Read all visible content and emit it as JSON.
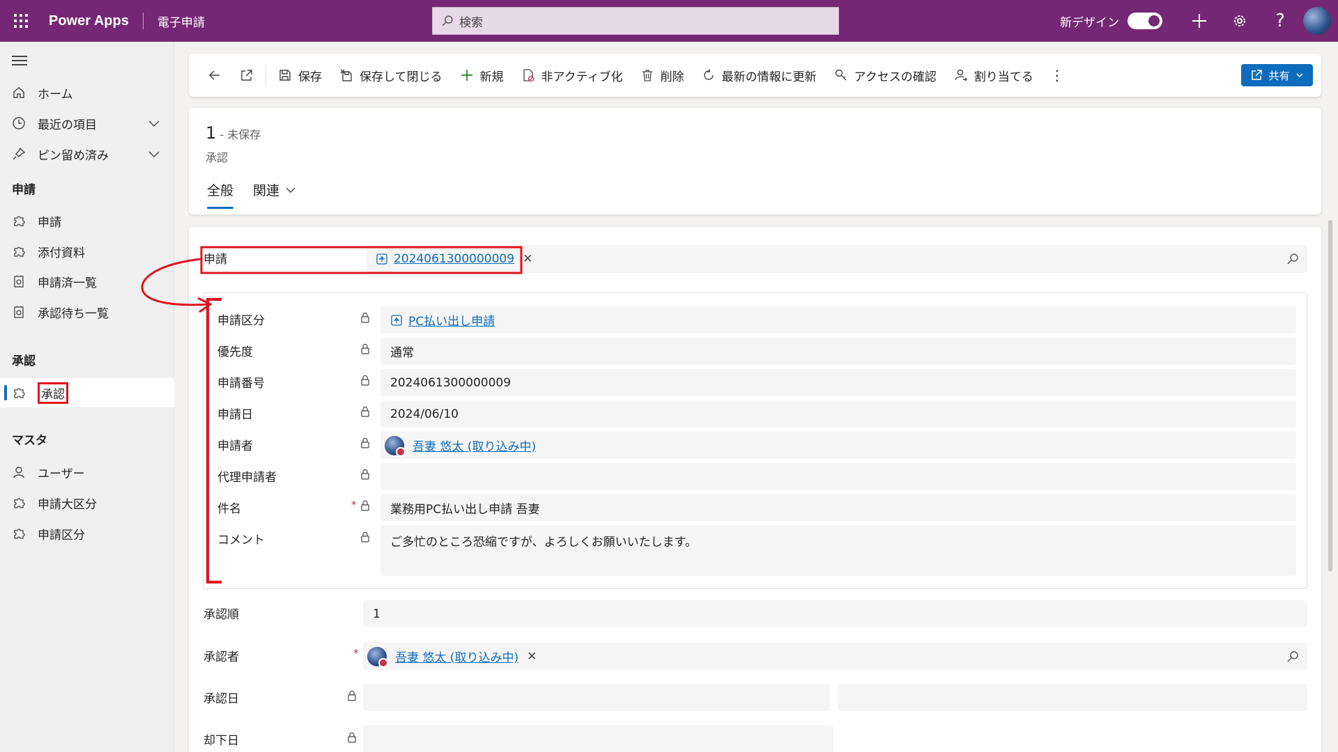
{
  "topbar": {
    "brand": "Power Apps",
    "app_name": "電子申請",
    "search_placeholder": "検索",
    "new_design_label": "新デザイン",
    "new_design_on": true
  },
  "sidebar": {
    "items": [
      {
        "label": "ホーム",
        "icon": "home-icon"
      },
      {
        "label": "最近の項目",
        "icon": "clock-icon"
      },
      {
        "label": "ピン留め済み",
        "icon": "pin-icon"
      }
    ],
    "sections": [
      {
        "title": "申請",
        "items": [
          {
            "label": "申請",
            "icon": "puzzle-icon"
          },
          {
            "label": "添付資料",
            "icon": "puzzle-icon"
          },
          {
            "label": "申請済一覧",
            "icon": "dashboard-icon"
          },
          {
            "label": "承認待ち一覧",
            "icon": "dashboard-icon"
          }
        ]
      },
      {
        "title": "承認",
        "items": [
          {
            "label": "承認",
            "icon": "puzzle-icon",
            "active": true
          }
        ]
      },
      {
        "title": "マスタ",
        "items": [
          {
            "label": "ユーザー",
            "icon": "person-icon"
          },
          {
            "label": "申請大区分",
            "icon": "puzzle-icon"
          },
          {
            "label": "申請区分",
            "icon": "puzzle-icon"
          }
        ]
      }
    ]
  },
  "commands": {
    "save": "保存",
    "save_close": "保存して閉じる",
    "new": "新規",
    "deactivate": "非アクティブ化",
    "delete": "削除",
    "refresh": "最新の情報に更新",
    "check_access": "アクセスの確認",
    "assign": "割り当てる",
    "share": "共有"
  },
  "header": {
    "record_title": "1",
    "unsaved": " - 未保存",
    "entity": "承認",
    "tabs": [
      "全般",
      "関連"
    ]
  },
  "form": {
    "application_label": "申請",
    "application_value": "2024061300000009",
    "quick_view": [
      {
        "label": "申請区分",
        "value": "PC払い出し申請",
        "type": "lookup"
      },
      {
        "label": "優先度",
        "value": "通常"
      },
      {
        "label": "申請番号",
        "value": "2024061300000009"
      },
      {
        "label": "申請日",
        "value": "2024/06/10"
      },
      {
        "label": "申請者",
        "value": "吾妻 悠太 (取り込み中)",
        "type": "person"
      },
      {
        "label": "代理申請者",
        "value": ""
      },
      {
        "label": "件名",
        "value": "業務用PC払い出し申請 吾妻",
        "required": true
      },
      {
        "label": "コメント",
        "value": "ご多忙のところ恐縮ですが、よろしくお願いいたします。"
      }
    ],
    "approval_order_label": "承認順",
    "approval_order_value": "1",
    "approver_label": "承認者",
    "approver_value": "吾妻 悠太 (取り込み中)",
    "approved_date_label": "承認日",
    "rejected_date_label": "却下日"
  },
  "colors": {
    "topbar": "#742774",
    "accent": "#0f6cbd",
    "annotation": "#e0141e"
  }
}
